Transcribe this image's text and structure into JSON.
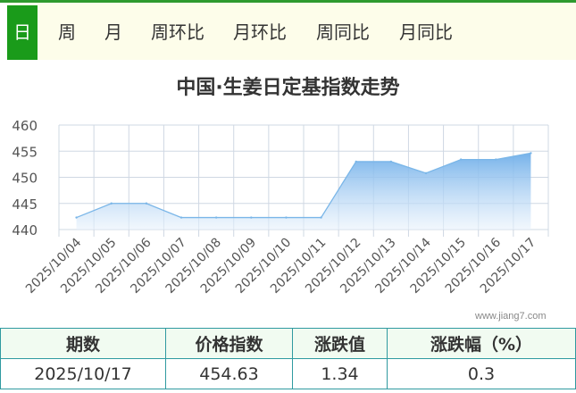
{
  "tabs": [
    {
      "label": "日",
      "active": true
    },
    {
      "label": "周",
      "active": false
    },
    {
      "label": "月",
      "active": false
    },
    {
      "label": "周环比",
      "active": false
    },
    {
      "label": "月环比",
      "active": false
    },
    {
      "label": "周同比",
      "active": false
    },
    {
      "label": "月同比",
      "active": false
    }
  ],
  "colors": {
    "accent": "#1a9b1a",
    "line": "#7ab6e8",
    "fill_top": "#6faee9",
    "grid": "#cfd8e3"
  },
  "watermark": "www.jiang7.com",
  "chart_data": {
    "type": "area",
    "title": "中国·生姜日定基指数走势",
    "x": [
      "2025/10/04",
      "2025/10/05",
      "2025/10/06",
      "2025/10/07",
      "2025/10/08",
      "2025/10/09",
      "2025/10/10",
      "2025/10/11",
      "2025/10/12",
      "2025/10/13",
      "2025/10/14",
      "2025/10/15",
      "2025/10/16",
      "2025/10/17"
    ],
    "values": [
      442.3,
      445.0,
      445.0,
      442.3,
      442.3,
      442.3,
      442.3,
      442.3,
      453.0,
      453.0,
      450.8,
      453.4,
      453.4,
      454.63
    ],
    "ylim": [
      440,
      460
    ],
    "yticks": [
      440,
      445,
      450,
      455,
      460
    ],
    "grid": true,
    "legend": "none"
  },
  "summary": {
    "headers": [
      "期数",
      "价格指数",
      "涨跌值",
      "涨跌幅（%）"
    ],
    "row": [
      "2025/10/17",
      "454.63",
      "1.34",
      "0.3"
    ]
  }
}
